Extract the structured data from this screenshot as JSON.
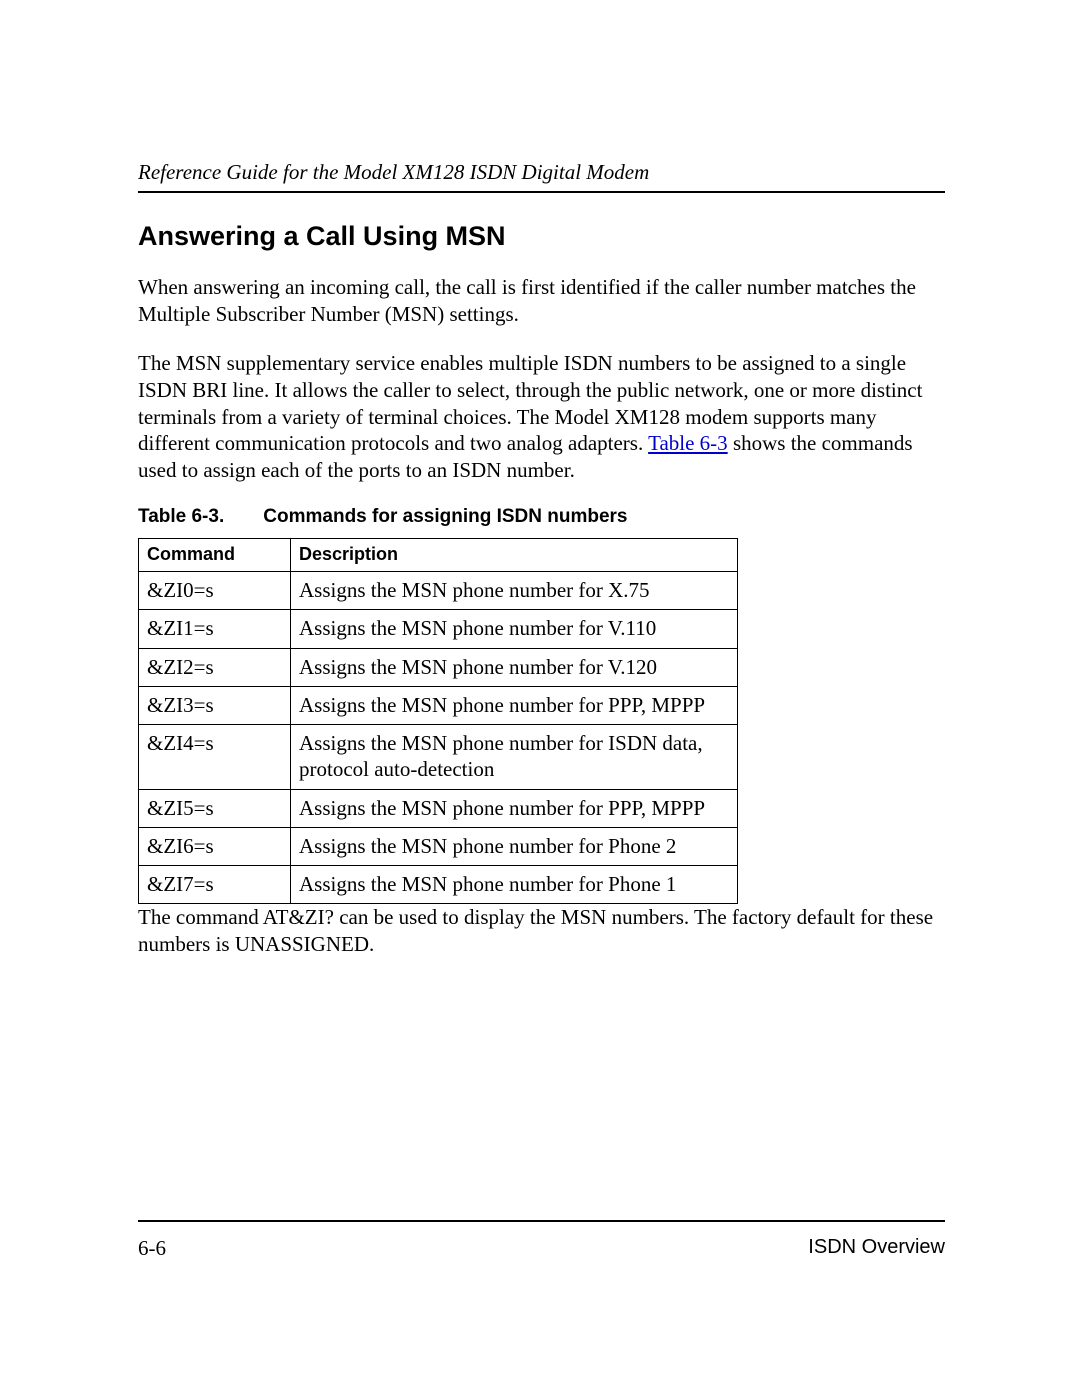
{
  "header": {
    "running_title": "Reference Guide for the Model XM128 ISDN Digital Modem"
  },
  "section": {
    "title": "Answering a Call Using MSN",
    "para1": "When answering an incoming call, the call is first identified if the caller number matches the Multiple Subscriber Number (MSN) settings.",
    "para2_pre": "The MSN supplementary service enables multiple ISDN numbers to be assigned to a single ISDN BRI line. It allows the caller to select, through the public network, one or more distinct terminals from a variety of terminal choices. The Model XM128 modem supports many different communication protocols and two analog adapters. ",
    "para2_link": "Table 6-3",
    "para2_post": " shows the commands used to assign each of the ports to an ISDN number."
  },
  "table": {
    "label": "Table 6-3.",
    "caption": "Commands for assigning ISDN numbers",
    "headers": {
      "c1": "Command",
      "c2": "Description"
    },
    "rows": [
      {
        "cmd": "&ZI0=s",
        "desc": "Assigns the MSN phone number for X.75"
      },
      {
        "cmd": "&ZI1=s",
        "desc": "Assigns the MSN phone number for V.110"
      },
      {
        "cmd": "&ZI2=s",
        "desc": "Assigns the MSN phone number for V.120"
      },
      {
        "cmd": "&ZI3=s",
        "desc": "Assigns the MSN phone number for PPP, MPPP"
      },
      {
        "cmd": "&ZI4=s",
        "desc": "Assigns the MSN phone number for ISDN data, protocol auto-detection"
      },
      {
        "cmd": "&ZI5=s",
        "desc": "Assigns the MSN phone number for PPP, MPPP"
      },
      {
        "cmd": "&ZI6=s",
        "desc": "Assigns the MSN phone number for Phone 2"
      },
      {
        "cmd": "&ZI7=s",
        "desc": "Assigns the MSN phone number for Phone 1"
      }
    ]
  },
  "after_table": "The command AT&ZI? can be used to display the MSN numbers. The factory default for these numbers is UNASSIGNED.",
  "footer": {
    "page": "6-6",
    "section": "ISDN Overview"
  }
}
